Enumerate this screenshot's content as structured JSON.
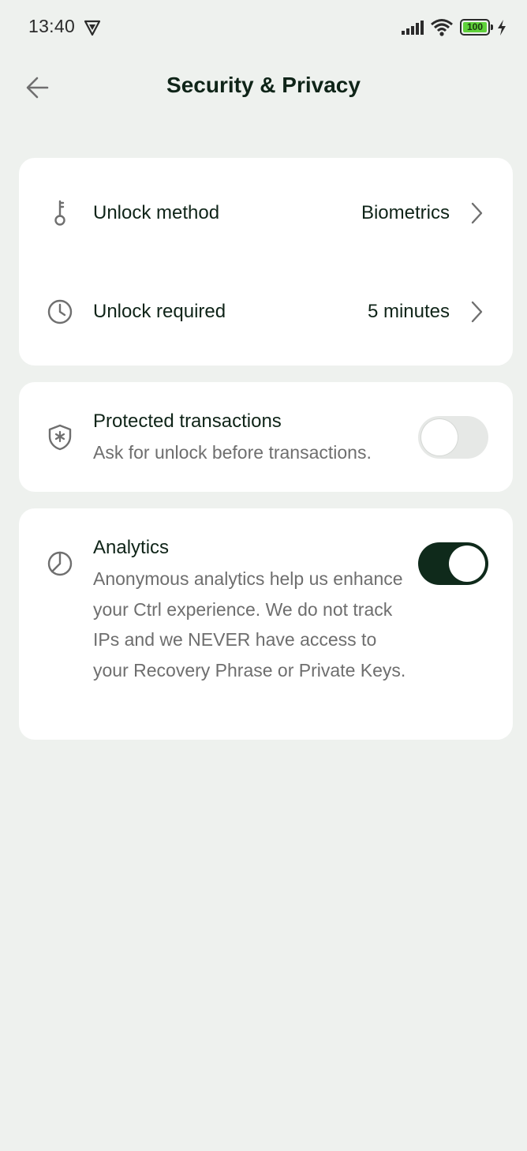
{
  "status_bar": {
    "time": "13:40",
    "battery_level": "100",
    "icons": [
      "vpn-icon",
      "signal-icon",
      "wifi-icon",
      "battery-icon",
      "charging-icon"
    ]
  },
  "header": {
    "title": "Security & Privacy",
    "back_icon": "back-arrow-icon"
  },
  "unlock_card": {
    "unlock_method": {
      "label": "Unlock method",
      "value": "Biometrics",
      "icon": "key-icon"
    },
    "unlock_required": {
      "label": "Unlock required",
      "value": "5 minutes",
      "icon": "clock-icon"
    }
  },
  "protected_transactions": {
    "title": "Protected transactions",
    "description": "Ask for unlock before transactions.",
    "enabled": false,
    "icon": "shield-asterisk-icon"
  },
  "analytics": {
    "title": "Analytics",
    "description": "Anonymous analytics help us enhance your Ctrl experience. We do not track IPs and we NEVER have access to your Recovery Phrase or Private Keys.",
    "enabled": true,
    "icon": "analytics-pie-icon"
  },
  "colors": {
    "background": "#eef1ee",
    "card": "#ffffff",
    "primary_text": "#0f2418",
    "secondary_text": "#6e6e6e",
    "toggle_on": "#0f2a1b",
    "toggle_off": "#e6e8e6",
    "battery_fill": "#5fd13a"
  }
}
